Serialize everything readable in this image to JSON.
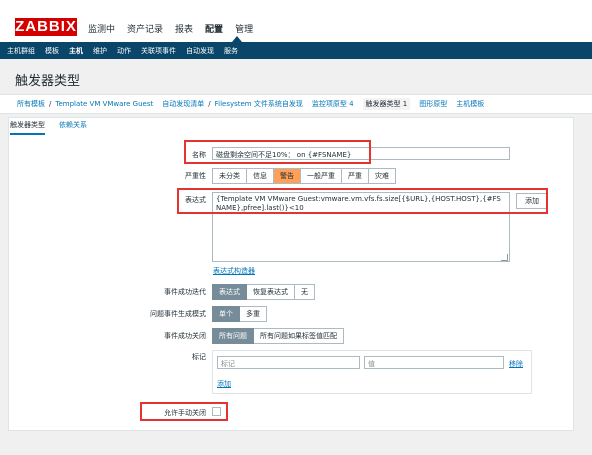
{
  "logo": "ZABBIX",
  "main_menu": [
    "监测中",
    "资产记录",
    "报表",
    "配置",
    "管理"
  ],
  "main_menu_active": 3,
  "sub_menu": [
    "主机群组",
    "模板",
    "主机",
    "维护",
    "动作",
    "关联项事件",
    "自动发现",
    "服务"
  ],
  "sub_menu_active": 2,
  "page_title": "触发器类型",
  "breadcrumb": {
    "all_templates": "所有模板",
    "sep": "/",
    "template": "Template VM VMware Guest",
    "discovery": "自动发现清单",
    "rule": "Filesystem 文件系统自发现",
    "item_proto": "监控项原型 4",
    "trigger_proto": "触发器类型 1",
    "graph_proto": "图形原型",
    "host_proto": "主机模板"
  },
  "tabs": [
    "触发器类型",
    "依赖关系"
  ],
  "form": {
    "name_label": "名称",
    "name_value": "磁盘剩余空间不足10%： on {#FSNAME}",
    "severity_label": "严重性",
    "severity_options": [
      "未分类",
      "信息",
      "警告",
      "一般严重",
      "严重",
      "灾难"
    ],
    "severity_selected": "警告",
    "expression_label": "表达式",
    "expression_value": "{Template VM VMware Guest:vmware.vm.vfs.fs.size[{$URL},{HOST.HOST},{#FSNAME},pfree].last()}<10",
    "add_button": "添加",
    "expr_constructor": "表达式构造器",
    "ok_event_label": "事件成功迭代",
    "ok_event_options": [
      "表达式",
      "恢复表达式",
      "无"
    ],
    "ok_event_selected": "表达式",
    "problem_mode_label": "问题事件生成模式",
    "problem_mode_options": [
      "单个",
      "多重"
    ],
    "problem_mode_selected": "单个",
    "ok_close_label": "事件成功关闭",
    "ok_close_options": [
      "所有问题",
      "所有问题如果标签值匹配"
    ],
    "ok_close_selected": "所有问题",
    "tags_label": "标记",
    "tag_placeholder": "标记",
    "value_placeholder": "值",
    "remove_link": "移除",
    "add_link": "添加",
    "manual_close_label": "允许手动关闭"
  },
  "colors": {
    "accent_red": "#d40000",
    "nav_blue": "#0a466a",
    "warning": "#ffa059",
    "highlight_box": "#e3342f"
  }
}
